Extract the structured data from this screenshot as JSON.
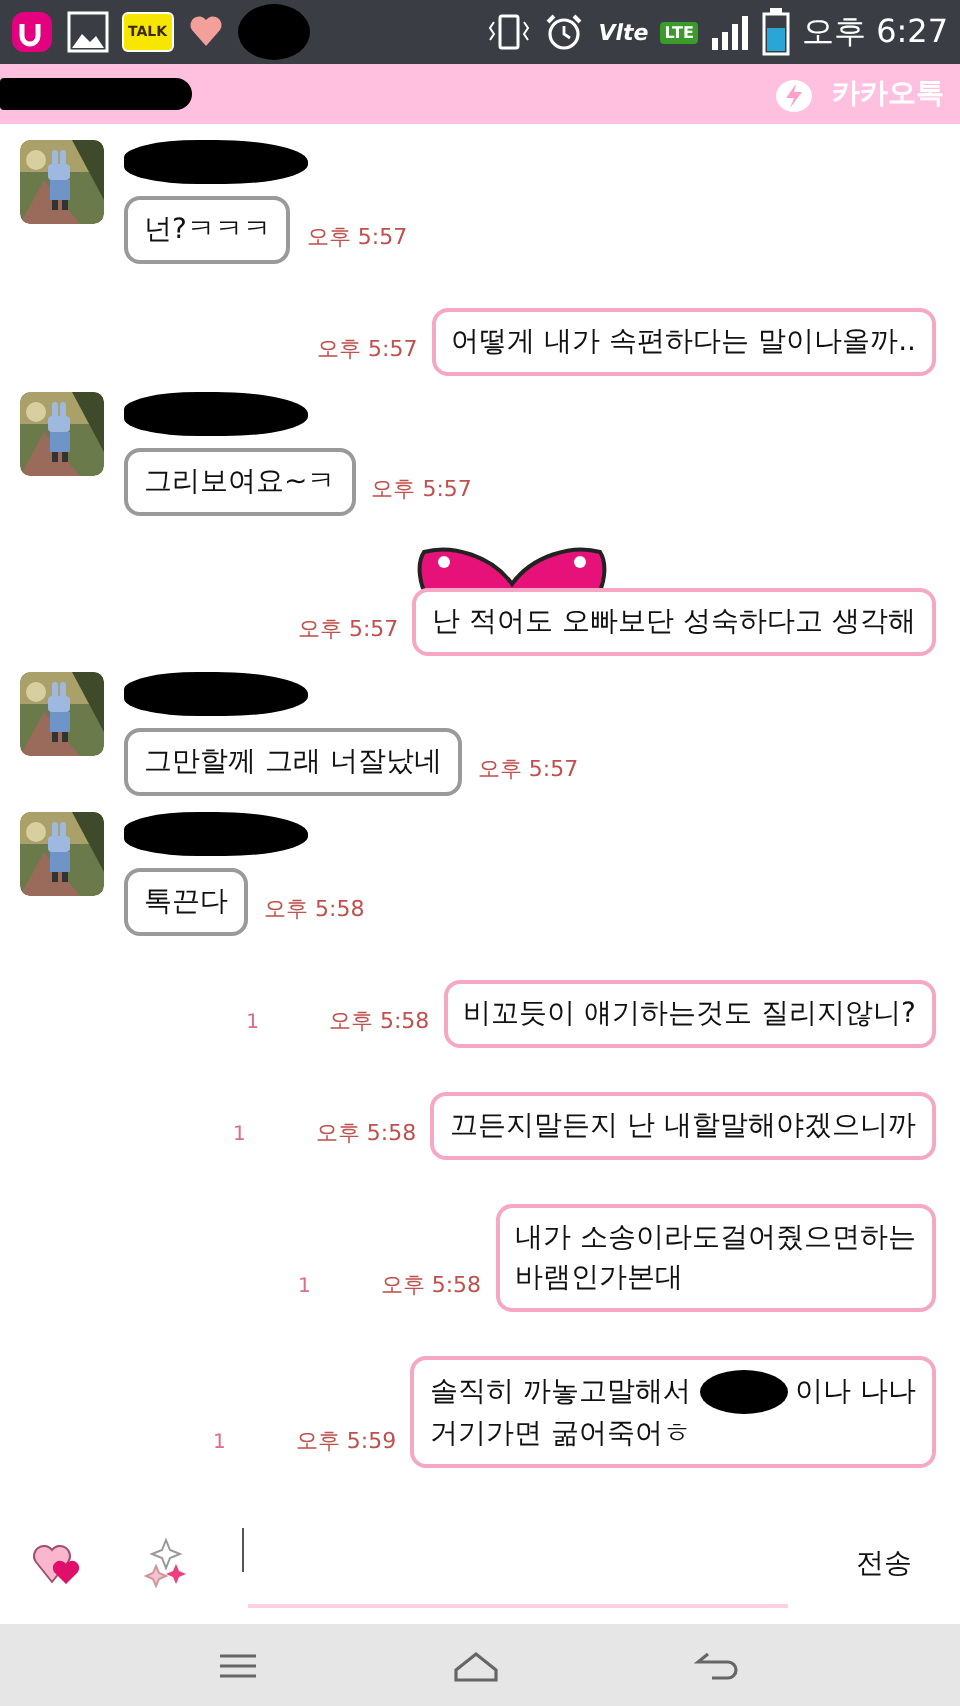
{
  "status_bar": {
    "notifications": [
      {
        "kind": "uplus"
      },
      {
        "kind": "gallery"
      },
      {
        "kind": "talk",
        "label": "TALK"
      },
      {
        "kind": "heart"
      },
      {
        "kind": "redacted"
      }
    ],
    "indicators": [
      {
        "kind": "vibrate"
      },
      {
        "kind": "alarm"
      },
      {
        "kind": "volte",
        "label": "Vlte"
      },
      {
        "kind": "lte",
        "label": "LTE"
      },
      {
        "kind": "signal"
      },
      {
        "kind": "battery"
      }
    ],
    "time": "오후 6:27"
  },
  "header": {
    "title": {
      "kind": "redacted"
    },
    "app_name": "카카오톡"
  },
  "messages": [
    {
      "kind": "incoming",
      "sender": {
        "kind": "redacted"
      },
      "parts": [
        {
          "kind": "text",
          "text": "넌?ㅋㅋㅋ"
        }
      ],
      "time": "오후 5:57"
    },
    {
      "kind": "outgoing",
      "parts": [
        {
          "kind": "text",
          "text": "어떻게 내가 속편하다는 말이나올까.."
        }
      ],
      "time": "오후 5:57"
    },
    {
      "kind": "incoming",
      "sender": {
        "kind": "redacted"
      },
      "parts": [
        {
          "kind": "text",
          "text": "그리보여요~ㅋ"
        }
      ],
      "time": "오후 5:57"
    },
    {
      "kind": "outgoing",
      "sticker": {
        "kind": "bow"
      },
      "parts": [
        {
          "kind": "text",
          "text": "난 적어도 오빠보단 성숙하다고 생각해"
        }
      ],
      "time": "오후 5:57"
    },
    {
      "kind": "incoming",
      "sender": {
        "kind": "redacted"
      },
      "parts": [
        {
          "kind": "text",
          "text": "그만할께 그래 너잘났네"
        }
      ],
      "time": "오후 5:57"
    },
    {
      "kind": "incoming",
      "sender": {
        "kind": "redacted"
      },
      "parts": [
        {
          "kind": "text",
          "text": "톡끈다"
        }
      ],
      "time": "오후 5:58"
    },
    {
      "kind": "outgoing",
      "unread": "1",
      "parts": [
        {
          "kind": "text",
          "text": "비꼬듯이 얘기하는것도 질리지않니?"
        }
      ],
      "time": "오후 5:58"
    },
    {
      "kind": "outgoing",
      "unread": "1",
      "parts": [
        {
          "kind": "text",
          "text": "끄든지말든지 난 내할말해야겠으니까"
        }
      ],
      "time": "오후 5:58"
    },
    {
      "kind": "outgoing",
      "unread": "1",
      "parts": [
        {
          "kind": "text",
          "text": "내가 소송이라도걸어줬으면하는"
        },
        {
          "kind": "break"
        },
        {
          "kind": "text",
          "text": "바램인가본대"
        }
      ],
      "time": "오후 5:58"
    },
    {
      "kind": "outgoing",
      "unread": "1",
      "parts": [
        {
          "kind": "text",
          "text": "솔직히 까놓고말해서"
        },
        {
          "kind": "redacted"
        },
        {
          "kind": "text",
          "text": "이나 나나"
        },
        {
          "kind": "break"
        },
        {
          "kind": "text",
          "text": "거기가면 굶어죽어ㅎ"
        }
      ],
      "time": "오후 5:59"
    }
  ],
  "input_bar": {
    "tools": [
      {
        "kind": "hearts"
      },
      {
        "kind": "sparkles"
      }
    ],
    "send_label": "전송"
  },
  "nav_bar": [
    {
      "kind": "menu"
    },
    {
      "kind": "home"
    },
    {
      "kind": "back"
    }
  ]
}
